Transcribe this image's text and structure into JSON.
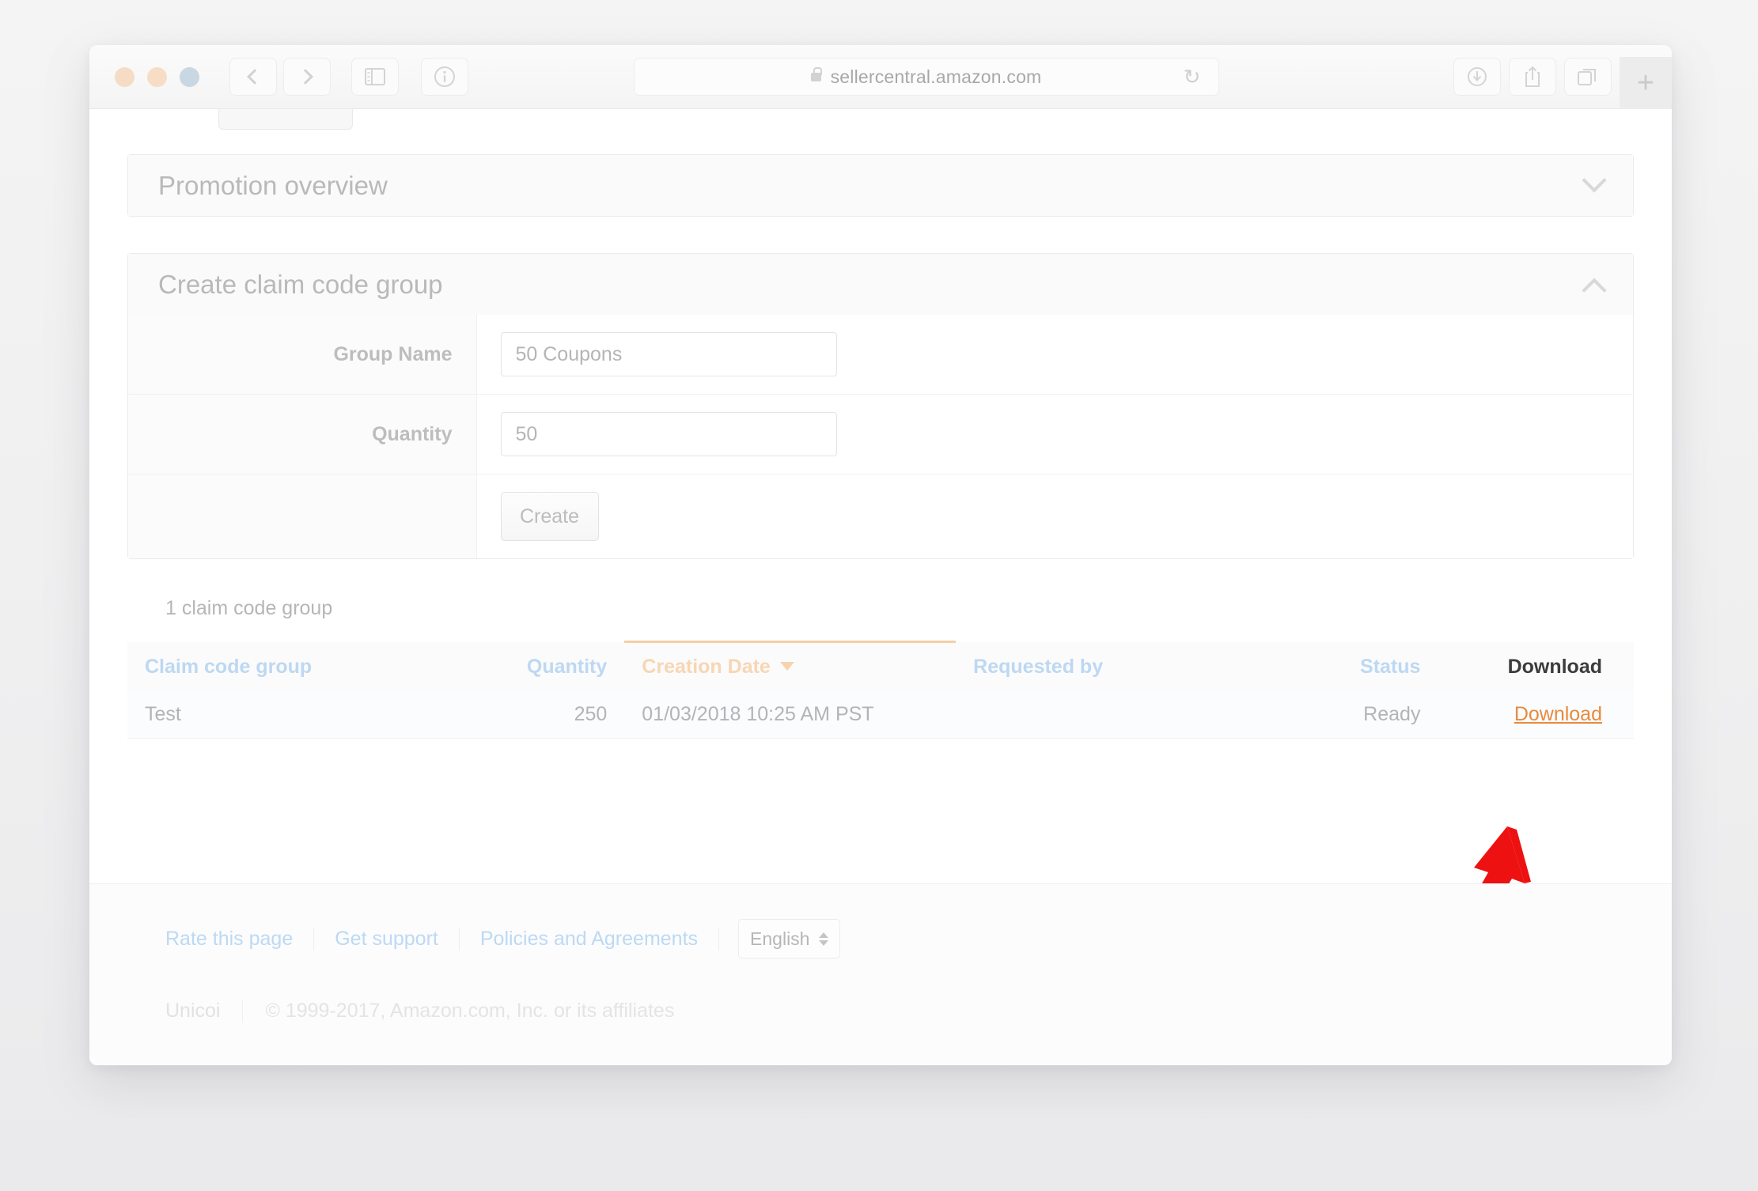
{
  "browser": {
    "url": "sellercentral.amazon.com",
    "lock_icon": "lock-icon",
    "back_label": "Back",
    "forward_label": "Forward",
    "sidebar_label": "Show sidebar",
    "info_label": "Site information",
    "reload_glyph": "↻",
    "downloads_label": "Downloads",
    "share_label": "Share",
    "tabs_label": "Show tabs",
    "new_tab_glyph": "+"
  },
  "panels": [
    {
      "title": "Promotion overview",
      "expanded": false,
      "chevron": "chevron-down-icon"
    },
    {
      "title": "Create claim code group",
      "expanded": true,
      "chevron": "chevron-up-icon"
    }
  ],
  "form": {
    "group_name_label": "Group Name",
    "group_name_value": "50 Coupons",
    "quantity_label": "Quantity",
    "quantity_value": "50",
    "create_label": "Create"
  },
  "results": {
    "count_text": "1 claim code group",
    "columns": [
      {
        "label": "Claim code group",
        "type": "link"
      },
      {
        "label": "Quantity",
        "type": "link"
      },
      {
        "label": "Creation Date",
        "type": "sorted",
        "sort_direction": "desc"
      },
      {
        "label": "Requested by",
        "type": "link"
      },
      {
        "label": "Status",
        "type": "link"
      },
      {
        "label": "Download",
        "type": "plain"
      }
    ],
    "rows": [
      {
        "claim_code_group": "Test",
        "quantity": "250",
        "creation_date": "01/03/2018 10:25 AM PST",
        "requested_by": "",
        "status": "Ready",
        "download": "Download"
      }
    ]
  },
  "annotation": {
    "arrow": "red-arrow-pointing-to-download",
    "color": "#ee1111"
  },
  "footer": {
    "links": [
      "Rate this page",
      "Get support",
      "Policies and Agreements"
    ],
    "language": "English",
    "unicoi": "Unicoi",
    "copyright": "© 1999-2017, Amazon.com, Inc. or its affiliates"
  },
  "colors": {
    "link_blue": "#bcd9f4",
    "sort_orange": "#f5cfa8",
    "download_orange": "#e88a3c",
    "annotation_red": "#ee1111"
  }
}
